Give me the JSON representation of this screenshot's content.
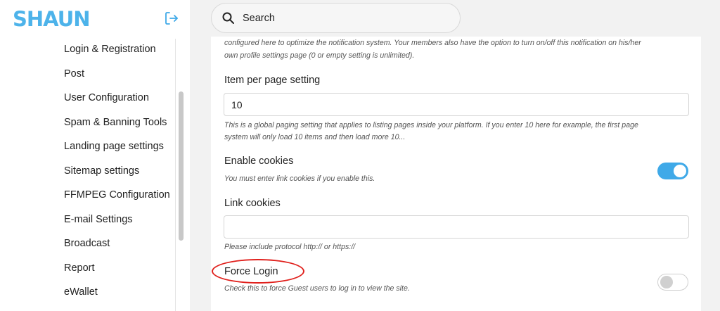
{
  "app": {
    "logo_text": "SHAUN",
    "brand_color": "#3fa9e8"
  },
  "sidebar": {
    "items": [
      {
        "label": "Login & Registration"
      },
      {
        "label": "Post"
      },
      {
        "label": "User Configuration"
      },
      {
        "label": "Spam & Banning Tools"
      },
      {
        "label": "Landing page settings"
      },
      {
        "label": "Sitemap settings"
      },
      {
        "label": "FFMPEG Configuration"
      },
      {
        "label": "E-mail Settings"
      },
      {
        "label": "Broadcast"
      },
      {
        "label": "Report"
      },
      {
        "label": "eWallet"
      }
    ]
  },
  "search": {
    "placeholder": "Search"
  },
  "settings": {
    "top_help_line1": "configured here to optimize the notification system. Your members also have the option to turn on/off this notification on his/her",
    "top_help_line2": "own profile settings page (0 or empty setting is unlimited).",
    "item_per_page": {
      "label": "Item per page setting",
      "value": "10",
      "help_line1": "This is a global paging setting that applies to listing pages inside your platform. If you enter 10 here for example, the first page",
      "help_line2": "system will only load 10 items and then load more 10..."
    },
    "enable_cookies": {
      "label": "Enable cookies",
      "help": "You must enter link cookies if you enable this.",
      "enabled": true
    },
    "link_cookies": {
      "label": "Link cookies",
      "value": "",
      "help": "Please include protocol http:// or https://"
    },
    "force_login": {
      "label": "Force Login",
      "help": "Check this to force Guest users to log in to view the site.",
      "enabled": false,
      "annotation_color": "#e0201c"
    }
  }
}
